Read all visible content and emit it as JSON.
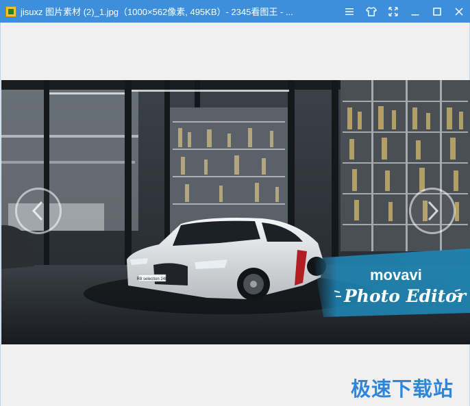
{
  "window": {
    "title": "jisuxz 图片素材 (2)_1.jpg（1000×562像素, 495KB）- 2345看图王 - ..."
  },
  "titlebar_buttons": [
    "menu",
    "skin",
    "fullscreen",
    "minimize",
    "maximize",
    "close"
  ],
  "icons": {
    "menu": "menu-icon",
    "skin": "shirt-icon",
    "fullscreen": "fullscreen-icon",
    "minimize": "minimize-icon",
    "maximize": "maximize-icon",
    "close": "close-icon",
    "prev": "chevron-left-icon",
    "next": "chevron-right-icon"
  },
  "image": {
    "brand_logo": "movavi",
    "brand_tagline": "Photo Editor",
    "license_plate": "R8 selection 24h"
  },
  "watermark": "极速下载站",
  "colors": {
    "titlebar": "#3d8fdc",
    "viewer_bg": "#f0f0f0",
    "banner": "#1e88b8",
    "watermark": "#2f86d8"
  }
}
